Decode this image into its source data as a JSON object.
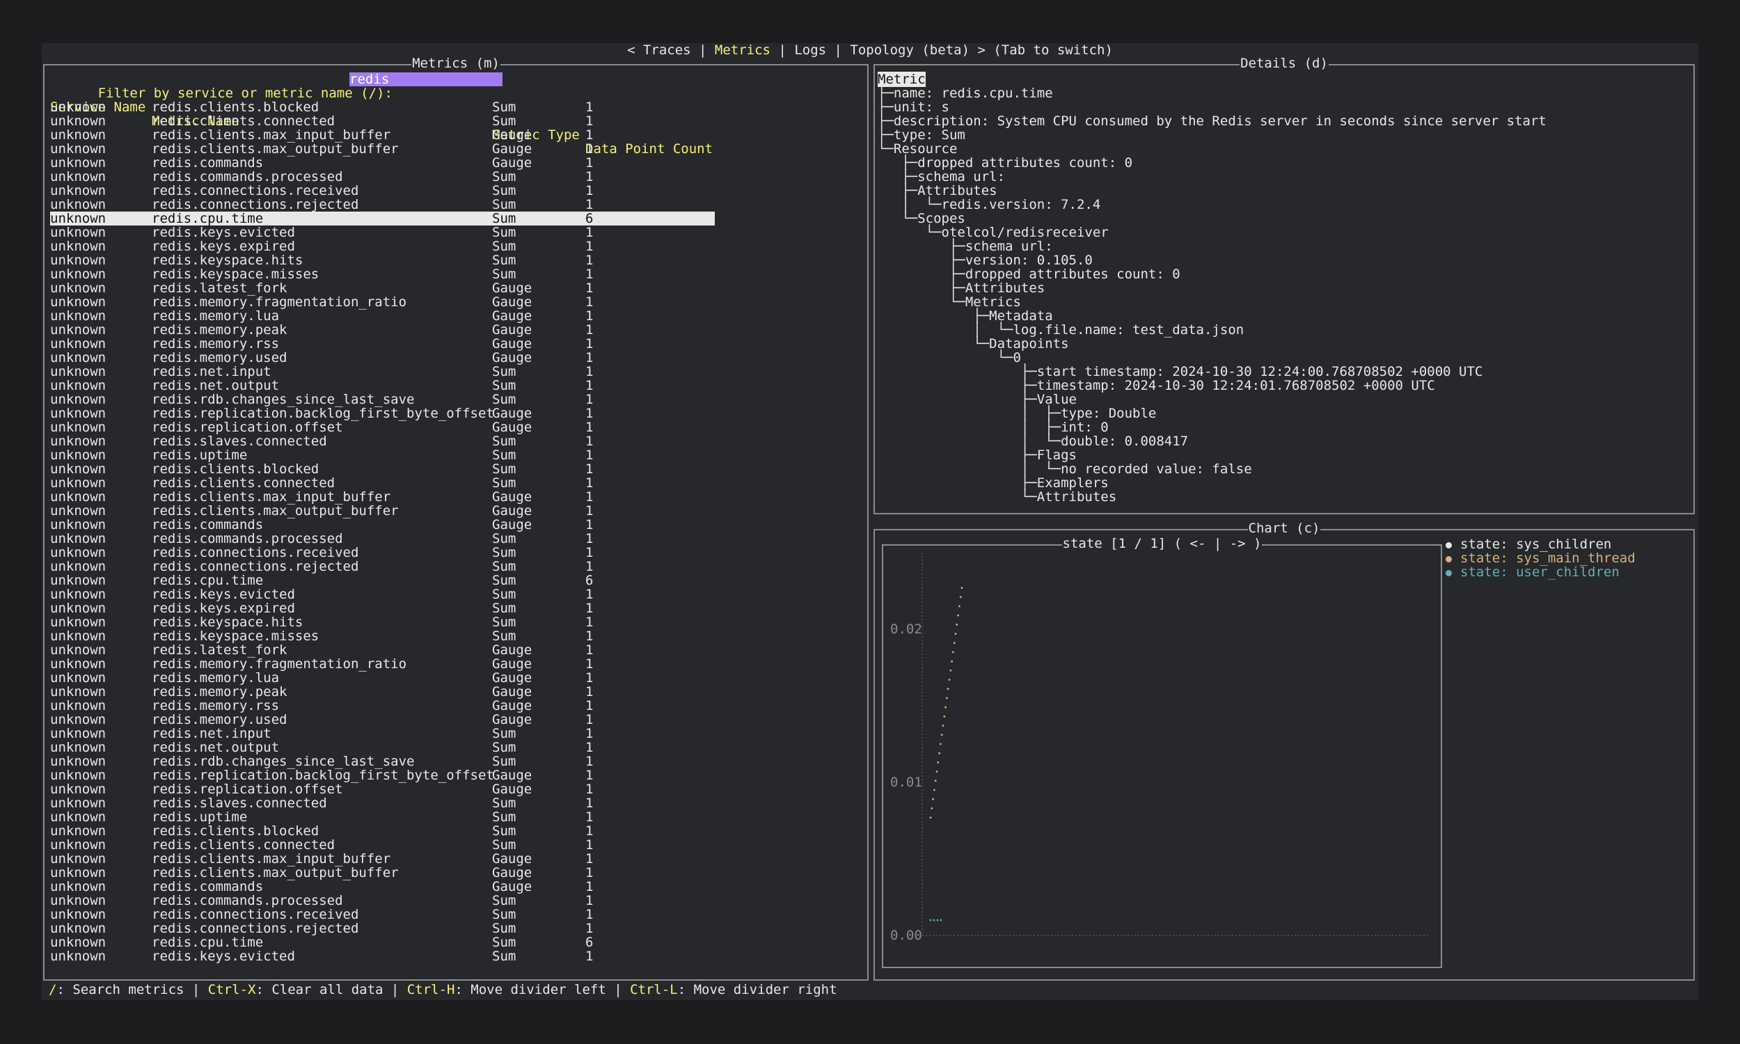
{
  "tabs": {
    "prefix": "< ",
    "traces": "Traces",
    "sep1": " | ",
    "metrics": "Metrics",
    "sep2": " | ",
    "logs": "Logs",
    "sep3": " | ",
    "topology": "Topology (beta)",
    "suffix": " > (Tab to switch)"
  },
  "metrics_panel": {
    "title": "Metrics (m)",
    "filter_label": "Filter by service or metric name (/):",
    "filter_value": "redis",
    "headers": {
      "service": "Service Name",
      "metric": "Metric Name",
      "type": "Metric Type",
      "count": "Data Point Count"
    },
    "selected_index": 8,
    "rows": [
      [
        "unknown",
        "redis.clients.blocked",
        "Sum",
        "1"
      ],
      [
        "unknown",
        "redis.clients.connected",
        "Sum",
        "1"
      ],
      [
        "unknown",
        "redis.clients.max_input_buffer",
        "Gauge",
        "1"
      ],
      [
        "unknown",
        "redis.clients.max_output_buffer",
        "Gauge",
        "1"
      ],
      [
        "unknown",
        "redis.commands",
        "Gauge",
        "1"
      ],
      [
        "unknown",
        "redis.commands.processed",
        "Sum",
        "1"
      ],
      [
        "unknown",
        "redis.connections.received",
        "Sum",
        "1"
      ],
      [
        "unknown",
        "redis.connections.rejected",
        "Sum",
        "1"
      ],
      [
        "unknown",
        "redis.cpu.time",
        "Sum",
        "6"
      ],
      [
        "unknown",
        "redis.keys.evicted",
        "Sum",
        "1"
      ],
      [
        "unknown",
        "redis.keys.expired",
        "Sum",
        "1"
      ],
      [
        "unknown",
        "redis.keyspace.hits",
        "Sum",
        "1"
      ],
      [
        "unknown",
        "redis.keyspace.misses",
        "Sum",
        "1"
      ],
      [
        "unknown",
        "redis.latest_fork",
        "Gauge",
        "1"
      ],
      [
        "unknown",
        "redis.memory.fragmentation_ratio",
        "Gauge",
        "1"
      ],
      [
        "unknown",
        "redis.memory.lua",
        "Gauge",
        "1"
      ],
      [
        "unknown",
        "redis.memory.peak",
        "Gauge",
        "1"
      ],
      [
        "unknown",
        "redis.memory.rss",
        "Gauge",
        "1"
      ],
      [
        "unknown",
        "redis.memory.used",
        "Gauge",
        "1"
      ],
      [
        "unknown",
        "redis.net.input",
        "Sum",
        "1"
      ],
      [
        "unknown",
        "redis.net.output",
        "Sum",
        "1"
      ],
      [
        "unknown",
        "redis.rdb.changes_since_last_save",
        "Sum",
        "1"
      ],
      [
        "unknown",
        "redis.replication.backlog_first_byte_offset",
        "Gauge",
        "1"
      ],
      [
        "unknown",
        "redis.replication.offset",
        "Gauge",
        "1"
      ],
      [
        "unknown",
        "redis.slaves.connected",
        "Sum",
        "1"
      ],
      [
        "unknown",
        "redis.uptime",
        "Sum",
        "1"
      ],
      [
        "unknown",
        "redis.clients.blocked",
        "Sum",
        "1"
      ],
      [
        "unknown",
        "redis.clients.connected",
        "Sum",
        "1"
      ],
      [
        "unknown",
        "redis.clients.max_input_buffer",
        "Gauge",
        "1"
      ],
      [
        "unknown",
        "redis.clients.max_output_buffer",
        "Gauge",
        "1"
      ],
      [
        "unknown",
        "redis.commands",
        "Gauge",
        "1"
      ],
      [
        "unknown",
        "redis.commands.processed",
        "Sum",
        "1"
      ],
      [
        "unknown",
        "redis.connections.received",
        "Sum",
        "1"
      ],
      [
        "unknown",
        "redis.connections.rejected",
        "Sum",
        "1"
      ],
      [
        "unknown",
        "redis.cpu.time",
        "Sum",
        "6"
      ],
      [
        "unknown",
        "redis.keys.evicted",
        "Sum",
        "1"
      ],
      [
        "unknown",
        "redis.keys.expired",
        "Sum",
        "1"
      ],
      [
        "unknown",
        "redis.keyspace.hits",
        "Sum",
        "1"
      ],
      [
        "unknown",
        "redis.keyspace.misses",
        "Sum",
        "1"
      ],
      [
        "unknown",
        "redis.latest_fork",
        "Gauge",
        "1"
      ],
      [
        "unknown",
        "redis.memory.fragmentation_ratio",
        "Gauge",
        "1"
      ],
      [
        "unknown",
        "redis.memory.lua",
        "Gauge",
        "1"
      ],
      [
        "unknown",
        "redis.memory.peak",
        "Gauge",
        "1"
      ],
      [
        "unknown",
        "redis.memory.rss",
        "Gauge",
        "1"
      ],
      [
        "unknown",
        "redis.memory.used",
        "Gauge",
        "1"
      ],
      [
        "unknown",
        "redis.net.input",
        "Sum",
        "1"
      ],
      [
        "unknown",
        "redis.net.output",
        "Sum",
        "1"
      ],
      [
        "unknown",
        "redis.rdb.changes_since_last_save",
        "Sum",
        "1"
      ],
      [
        "unknown",
        "redis.replication.backlog_first_byte_offset",
        "Gauge",
        "1"
      ],
      [
        "unknown",
        "redis.replication.offset",
        "Gauge",
        "1"
      ],
      [
        "unknown",
        "redis.slaves.connected",
        "Sum",
        "1"
      ],
      [
        "unknown",
        "redis.uptime",
        "Sum",
        "1"
      ],
      [
        "unknown",
        "redis.clients.blocked",
        "Sum",
        "1"
      ],
      [
        "unknown",
        "redis.clients.connected",
        "Sum",
        "1"
      ],
      [
        "unknown",
        "redis.clients.max_input_buffer",
        "Gauge",
        "1"
      ],
      [
        "unknown",
        "redis.clients.max_output_buffer",
        "Gauge",
        "1"
      ],
      [
        "unknown",
        "redis.commands",
        "Gauge",
        "1"
      ],
      [
        "unknown",
        "redis.commands.processed",
        "Sum",
        "1"
      ],
      [
        "unknown",
        "redis.connections.received",
        "Sum",
        "1"
      ],
      [
        "unknown",
        "redis.connections.rejected",
        "Sum",
        "1"
      ],
      [
        "unknown",
        "redis.cpu.time",
        "Sum",
        "6"
      ],
      [
        "unknown",
        "redis.keys.evicted",
        "Sum",
        "1"
      ]
    ]
  },
  "details_panel": {
    "title": "Details (d)",
    "lines": [
      "Metric",
      "├─name: redis.cpu.time",
      "├─unit: s",
      "├─description: System CPU consumed by the Redis server in seconds since server start",
      "├─type: Sum",
      "└─Resource",
      "   ├─dropped attributes count: 0",
      "   ├─schema url:",
      "   ├─Attributes",
      "   │  └─redis.version: 7.2.4",
      "   └─Scopes",
      "      └─otelcol/redisreceiver",
      "         ├─schema url:",
      "         ├─version: 0.105.0",
      "         ├─dropped attributes count: 0",
      "         ├─Attributes",
      "         └─Metrics",
      "            ├─Metadata",
      "            │  └─log.file.name: test_data.json",
      "            └─Datapoints",
      "               └─0",
      "                  ├─start timestamp: 2024-10-30 12:24:00.768708502 +0000 UTC",
      "                  ├─timestamp: 2024-10-30 12:24:01.768708502 +0000 UTC",
      "                  ├─Value",
      "                  │  ├─type: Double",
      "                  │  ├─int: 0",
      "                  │  └─double: 0.008417",
      "                  ├─Flags",
      "                  │  └─no recorded value: false",
      "                  ├─Examplers",
      "                  └─Attributes"
    ]
  },
  "chart_panel": {
    "title": "Chart (c)",
    "subtitle": "state [1 / 1] ( <- | -> )"
  },
  "chart_data": {
    "type": "scatter",
    "ylim": [
      0,
      0.025
    ],
    "yticks": [
      "0.00",
      "0.01",
      "0.02"
    ],
    "ytick_values": [
      0,
      0.01,
      0.02
    ],
    "series": [
      {
        "name": "state: sys_children",
        "color": "#e8e8e8",
        "y": []
      },
      {
        "name": "state: sys_main_thread",
        "color": "#d6b27c",
        "y": [
          0.0077,
          0.0083,
          0.0089,
          0.0095,
          0.0101,
          0.0107,
          0.0113,
          0.0119,
          0.0125,
          0.0131,
          0.0137,
          0.0143,
          0.0149,
          0.0155,
          0.0161,
          0.0167,
          0.0173,
          0.0179,
          0.0185,
          0.0191,
          0.0197,
          0.0203,
          0.0209,
          0.0215,
          0.0221,
          0.0227
        ]
      },
      {
        "name": "state: user_children",
        "color": "#5fb2ae",
        "y": [
          0.001,
          0.001,
          0.001,
          0.001
        ]
      }
    ]
  },
  "footer": {
    "k1": "/",
    "t1": ": Search metrics | ",
    "k2": "Ctrl-X",
    "t2": ": Clear all data | ",
    "k3": "Ctrl-H",
    "t3": ": Move divider left | ",
    "k4": "Ctrl-L",
    "t4": ": Move divider right"
  }
}
